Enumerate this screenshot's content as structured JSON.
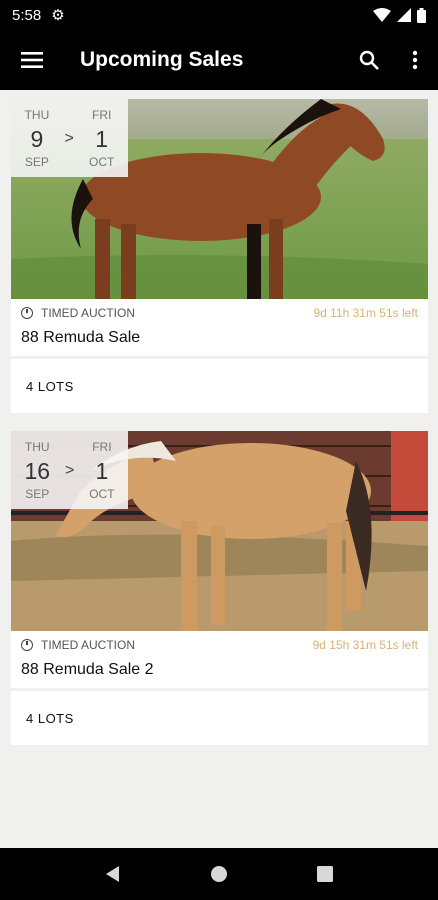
{
  "status_bar": {
    "time": "5:58"
  },
  "app_bar": {
    "title": "Upcoming Sales"
  },
  "sales": [
    {
      "start": {
        "dow": "THU",
        "day": "9",
        "month": "SEP"
      },
      "end": {
        "dow": "FRI",
        "day": "1",
        "month": "OCT"
      },
      "separator": ">",
      "type": "TIMED AUCTION",
      "time_left": "9d 11h 31m 51s left",
      "name": "88 Remuda Sale",
      "lots": "4 LOTS",
      "image": "bay horse standing in green pasture"
    },
    {
      "start": {
        "dow": "THU",
        "day": "16",
        "month": "SEP"
      },
      "end": {
        "dow": "FRI",
        "day": "1",
        "month": "OCT"
      },
      "separator": ">",
      "type": "TIMED AUCTION",
      "time_left": "9d 15h 31m 51s left",
      "name": "88 Remuda Sale 2",
      "lots": "4 LOTS",
      "image": "palomino horse standing in dirt corral"
    }
  ],
  "colors": {
    "bar_background": "#000000",
    "content_background": "#f0f0ee",
    "time_left_accent": "#d8b07a"
  }
}
